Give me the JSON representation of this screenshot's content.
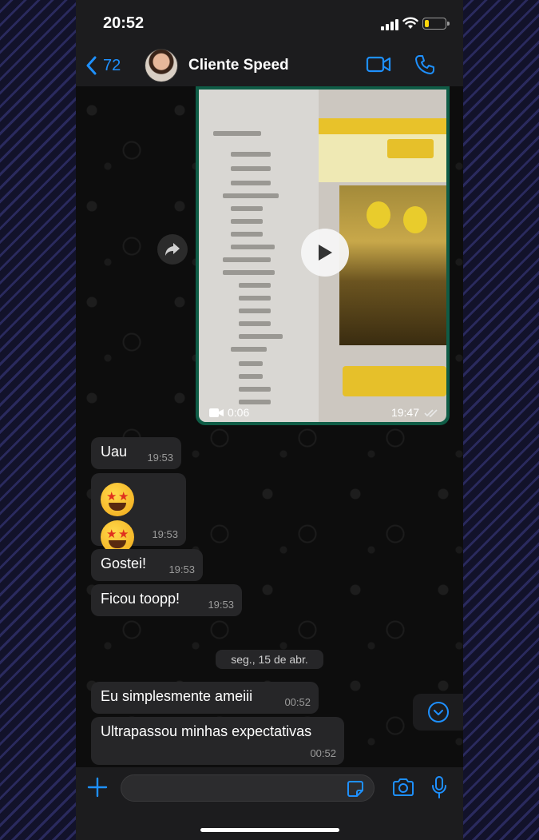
{
  "status_bar": {
    "time": "20:52"
  },
  "header": {
    "back_count": "72",
    "contact_name": "Cliente Speed"
  },
  "video_message": {
    "duration": "0:06",
    "time": "19:47"
  },
  "messages": [
    {
      "text": "Uau",
      "time": "19:53"
    },
    {
      "emoji": "🤩🤩",
      "time": "19:53"
    },
    {
      "text": "Gostei!",
      "time": "19:53"
    },
    {
      "text": "Ficou toopp!",
      "time": "19:53"
    }
  ],
  "date_separator": "seg., 15 de abr.",
  "messages_after": [
    {
      "text": "Eu simplesmente ameiii",
      "time": "00:52"
    },
    {
      "text": "Ultrapassou minhas expectativas",
      "time": "00:52"
    }
  ],
  "input": {
    "placeholder": ""
  },
  "colors": {
    "accent": "#1e90ff",
    "bubble": "#262628",
    "bar": "#1c1c1e",
    "video_border": "#0f5c46"
  },
  "icons": [
    "signal-icon",
    "wifi-icon",
    "battery-icon",
    "back-chevron-icon",
    "video-call-icon",
    "phone-icon",
    "play-icon",
    "forward-icon",
    "video-camera-icon",
    "double-check-icon",
    "chevron-down-icon",
    "plus-icon",
    "sticker-icon",
    "camera-icon",
    "microphone-icon"
  ]
}
